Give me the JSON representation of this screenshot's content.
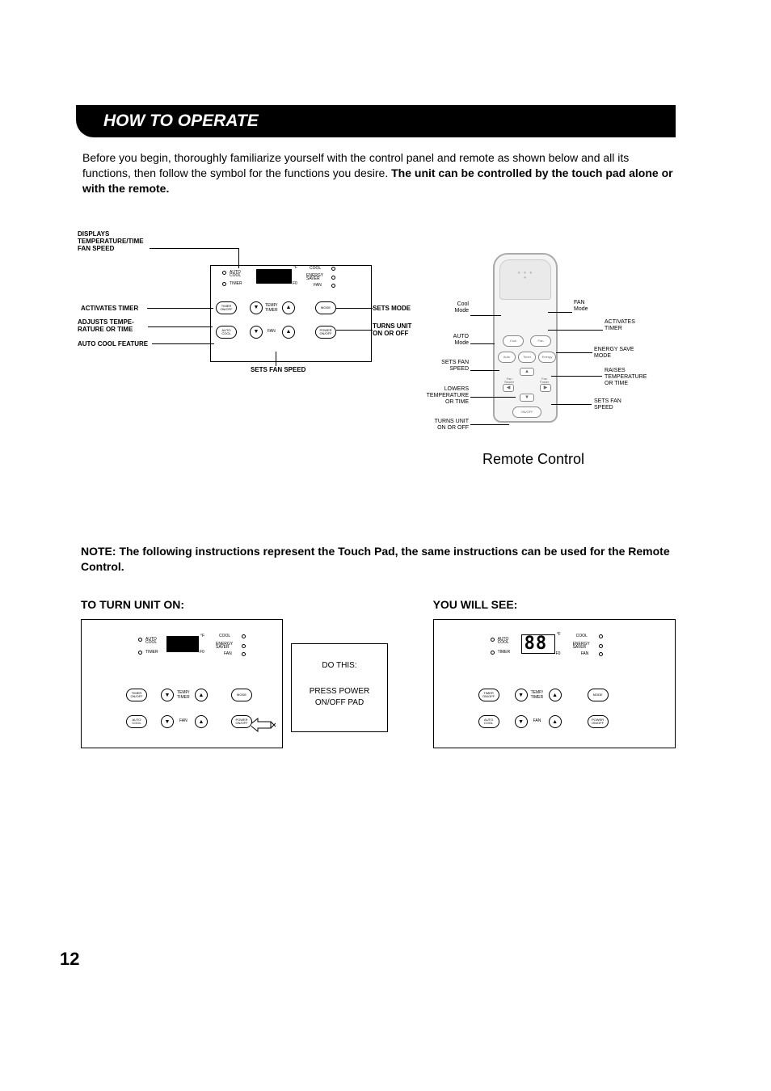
{
  "header": "HOW TO OPERATE",
  "intro_plain": "Before you begin, thoroughly familiarize yourself with the control panel and remote as shown below and all its functions, then follow the symbol for the functions you desire. ",
  "intro_bold": "The unit can be controlled by the touch pad alone or with the remote.",
  "panel": {
    "callouts_left": {
      "displays": "DISPLAYS\nTEMPERATURE/TIME\nFAN SPEED",
      "activates": "ACTIVATES TIMER",
      "adjusts": "ADJUSTS TEMPE-\nRATURE OR TIME",
      "autocool": "AUTO COOL FEATURE"
    },
    "callouts_right": {
      "setsmode": "SETS MODE",
      "turnsunit": "TURNS UNIT\nON OR OFF",
      "setsfan": "SETS FAN SPEED"
    },
    "indicators_left": {
      "auto": "AUTO\nCOOL",
      "timer": "TIMER"
    },
    "indicators_right": {
      "cool": "COOL",
      "energy": "ENERGY\nSAVER",
      "fan": "FAN"
    },
    "buttons": {
      "timer_onoff": "TIMER\nON/OFF",
      "temp_timer": "TEMP/\nTIMER",
      "mode": "MODE",
      "auto_cool": "AUTO\nCOOL",
      "fan": "FAN",
      "power": "POWER\nON/OFF"
    },
    "display_unit_top": "°F",
    "display_unit_bot": "F0"
  },
  "remote": {
    "title": "Remote Control",
    "buttons": {
      "cool": "Cool",
      "fan": "Fan",
      "auto": "Auto",
      "timer": "Timer",
      "energy": "Energy",
      "fan_slower": "Fan\nSlower",
      "fan_faster": "Fan\nFaster",
      "onoff": "ON/OFF"
    },
    "callouts_left": {
      "cool_mode": "Cool\nMode",
      "auto_mode": "AUTO\nMode",
      "sets_fan": "SETS FAN\nSPEED",
      "lowers": "LOWERS\nTEMPERATURE\nOR TIME",
      "turns": "TURNS UNIT\nON OR OFF"
    },
    "callouts_right": {
      "fan_mode": "FAN\nMode",
      "activates": "ACTIVATES\nTIMER",
      "energy": "ENERGY SAVE\nMODE",
      "raises": "RAISES\nTEMPERATURE\nOR TIME",
      "sets_fan": "SETS FAN\nSPEED"
    }
  },
  "note_text": "NOTE: The following instructions represent the Touch Pad, the same instructions can be used for the Remote Control.",
  "steps": {
    "left_head": "TO TURN UNIT ON:",
    "right_head": "YOU WILL SEE:",
    "do_this": "DO THIS:",
    "press": "PRESS POWER\nON/OFF PAD",
    "display_value": "88"
  },
  "page_number": "12"
}
